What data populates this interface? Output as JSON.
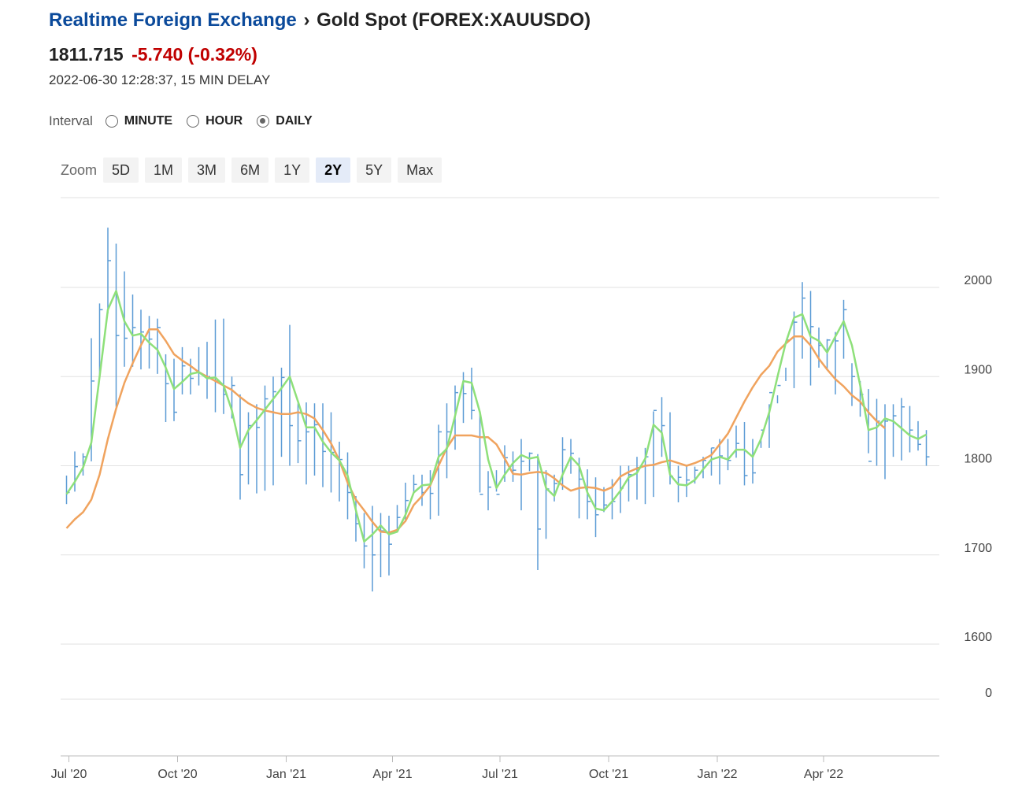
{
  "header": {
    "breadcrumb_link": "Realtime Foreign Exchange",
    "breadcrumb_sep": "›",
    "symbol_title": "Gold Spot (FOREX:XAUUSDO)",
    "price": "1811.715",
    "change": "-5.740 (-0.32%)",
    "timestamp": "2022-06-30 12:28:37, 15 MIN DELAY",
    "change_color": "#c00000",
    "link_color": "#0b4a9b"
  },
  "interval": {
    "label": "Interval",
    "options": [
      "MINUTE",
      "HOUR",
      "DAILY"
    ],
    "selected": "DAILY"
  },
  "zoom": {
    "label": "Zoom",
    "options": [
      "5D",
      "1M",
      "3M",
      "6M",
      "1Y",
      "2Y",
      "5Y",
      "Max"
    ],
    "selected": "2Y"
  },
  "chart_data": {
    "type": "line",
    "title": "",
    "xlabel": "",
    "ylabel": "",
    "x_tick_labels": [
      "Jul '20",
      "Oct '20",
      "Jan '21",
      "Apr '21",
      "Jul '21",
      "Oct '21",
      "Jan '22",
      "Apr '22"
    ],
    "y_tick_labels": [
      "2000",
      "1900",
      "1800",
      "1700",
      "1600",
      "0"
    ],
    "y_ticks": [
      2000,
      1900,
      1800,
      1700,
      1600
    ],
    "ylim": [
      1600,
      2100
    ],
    "grid": true,
    "colors": {
      "bars": "#5b9bd5",
      "fast_ma": "#8ee07a",
      "slow_ma": "#f0a35e",
      "grid": "#e2e2e2",
      "axis": "#bbbbbb"
    },
    "x": [
      "2020-06-29",
      "2020-07-06",
      "2020-07-13",
      "2020-07-20",
      "2020-07-27",
      "2020-08-03",
      "2020-08-10",
      "2020-08-17",
      "2020-08-24",
      "2020-08-31",
      "2020-09-07",
      "2020-09-14",
      "2020-09-21",
      "2020-09-28",
      "2020-10-05",
      "2020-10-12",
      "2020-10-19",
      "2020-10-26",
      "2020-11-02",
      "2020-11-09",
      "2020-11-16",
      "2020-11-23",
      "2020-11-30",
      "2020-12-07",
      "2020-12-14",
      "2020-12-21",
      "2020-12-28",
      "2021-01-04",
      "2021-01-11",
      "2021-01-18",
      "2021-01-25",
      "2021-02-01",
      "2021-02-08",
      "2021-02-15",
      "2021-02-22",
      "2021-03-01",
      "2021-03-08",
      "2021-03-15",
      "2021-03-22",
      "2021-03-29",
      "2021-04-05",
      "2021-04-12",
      "2021-04-19",
      "2021-04-26",
      "2021-05-03",
      "2021-05-10",
      "2021-05-17",
      "2021-05-24",
      "2021-05-31",
      "2021-06-07",
      "2021-06-14",
      "2021-06-21",
      "2021-06-28",
      "2021-07-05",
      "2021-07-12",
      "2021-07-19",
      "2021-07-26",
      "2021-08-02",
      "2021-08-09",
      "2021-08-16",
      "2021-08-23",
      "2021-08-30",
      "2021-09-06",
      "2021-09-13",
      "2021-09-20",
      "2021-09-27",
      "2021-10-04",
      "2021-10-11",
      "2021-10-18",
      "2021-10-25",
      "2021-11-01",
      "2021-11-08",
      "2021-11-15",
      "2021-11-22",
      "2021-11-29",
      "2021-12-06",
      "2021-12-13",
      "2021-12-20",
      "2021-12-27",
      "2022-01-03",
      "2022-01-10",
      "2022-01-17",
      "2022-01-24",
      "2022-01-31",
      "2022-02-07",
      "2022-02-14",
      "2022-02-21",
      "2022-02-28",
      "2022-03-07",
      "2022-03-14",
      "2022-03-21",
      "2022-03-28",
      "2022-04-04",
      "2022-04-11",
      "2022-04-18",
      "2022-04-25",
      "2022-05-02",
      "2022-05-09",
      "2022-05-16",
      "2022-05-23",
      "2022-05-30",
      "2022-06-06",
      "2022-06-13",
      "2022-06-20",
      "2022-06-27"
    ],
    "high": [
      1789,
      1816,
      1814,
      1943,
      1982,
      2067,
      2049,
      2018,
      1992,
      1975,
      1968,
      1965,
      1925,
      1920,
      1933,
      1920,
      1933,
      1939,
      1964,
      1965,
      1900,
      1880,
      1860,
      1869,
      1890,
      1900,
      1910,
      1958,
      1870,
      1871,
      1870,
      1870,
      1860,
      1827,
      1815,
      1766,
      1747,
      1755,
      1747,
      1744,
      1756,
      1781,
      1790,
      1790,
      1795,
      1846,
      1870,
      1890,
      1905,
      1910,
      1861,
      1794,
      1795,
      1823,
      1816,
      1830,
      1815,
      1813,
      1795,
      1790,
      1832,
      1830,
      1809,
      1796,
      1787,
      1776,
      1785,
      1800,
      1800,
      1810,
      1820,
      1861,
      1877,
      1860,
      1800,
      1800,
      1799,
      1810,
      1820,
      1830,
      1830,
      1845,
      1849,
      1830,
      1830,
      1869,
      1879,
      1910,
      1973,
      2006,
      1996,
      1955,
      1942,
      1950,
      1986,
      1915,
      1895,
      1886,
      1875,
      1869,
      1869,
      1876,
      1867,
      1850,
      1840
    ],
    "low": [
      1757,
      1771,
      1789,
      1805,
      1902,
      1971,
      1866,
      1911,
      1911,
      1908,
      1909,
      1903,
      1849,
      1850,
      1880,
      1880,
      1890,
      1875,
      1860,
      1858,
      1853,
      1762,
      1779,
      1769,
      1772,
      1778,
      1810,
      1800,
      1803,
      1779,
      1789,
      1776,
      1770,
      1760,
      1740,
      1715,
      1685,
      1659,
      1675,
      1677,
      1726,
      1737,
      1770,
      1755,
      1740,
      1744,
      1786,
      1818,
      1848,
      1852,
      1770,
      1750,
      1771,
      1782,
      1782,
      1750,
      1794,
      1683,
      1718,
      1760,
      1773,
      1791,
      1741,
      1740,
      1720,
      1748,
      1740,
      1747,
      1760,
      1762,
      1757,
      1765,
      1810,
      1779,
      1759,
      1765,
      1780,
      1786,
      1789,
      1779,
      1795,
      1809,
      1778,
      1780,
      1820,
      1820,
      1870,
      1895,
      1887,
      1920,
      1890,
      1910,
      1907,
      1880,
      1920,
      1867,
      1855,
      1814,
      1800,
      1785,
      1810,
      1806,
      1815,
      1817,
      1800
    ],
    "bar_close": [
      1770,
      1799,
      1810,
      1895,
      1975,
      2030,
      1946,
      1943,
      1955,
      1950,
      1942,
      1955,
      1892,
      1860,
      1912,
      1898,
      1904,
      1900,
      1895,
      1880,
      1890,
      1790,
      1845,
      1843,
      1875,
      1883,
      1899,
      1845,
      1828,
      1838,
      1846,
      1816,
      1815,
      1807,
      1770,
      1735,
      1710,
      1700,
      1727,
      1712,
      1742,
      1761,
      1779,
      1770,
      1769,
      1838,
      1838,
      1882,
      1881,
      1862,
      1768,
      1776,
      1768,
      1809,
      1795,
      1805,
      1814,
      1729,
      1774,
      1780,
      1818,
      1814,
      1785,
      1760,
      1745,
      1756,
      1760,
      1775,
      1790,
      1798,
      1810,
      1862,
      1845,
      1788,
      1787,
      1784,
      1795,
      1806,
      1820,
      1811,
      1806,
      1825,
      1789,
      1792,
      1840,
      1882,
      1890,
      1941,
      1961,
      1988,
      1956,
      1935,
      1941,
      1940,
      1975,
      1900,
      1880,
      1805,
      1850,
      1850,
      1856,
      1866,
      1840,
      1824,
      1810
    ],
    "series": [
      {
        "name": "",
        "color": "#8ee07a",
        "values": [
          1768,
          1782,
          1798,
          1826,
          1900,
          1975,
          1996,
          1962,
          1946,
          1948,
          1938,
          1930,
          1910,
          1886,
          1894,
          1903,
          1905,
          1898,
          1899,
          1890,
          1862,
          1820,
          1840,
          1851,
          1863,
          1875,
          1887,
          1900,
          1872,
          1843,
          1843,
          1827,
          1815,
          1806,
          1789,
          1750,
          1715,
          1723,
          1733,
          1723,
          1726,
          1745,
          1770,
          1778,
          1779,
          1810,
          1819,
          1856,
          1895,
          1893,
          1860,
          1807,
          1775,
          1790,
          1803,
          1812,
          1808,
          1810,
          1775,
          1766,
          1790,
          1810,
          1800,
          1770,
          1752,
          1750,
          1760,
          1772,
          1787,
          1792,
          1808,
          1846,
          1837,
          1790,
          1779,
          1778,
          1784,
          1796,
          1807,
          1810,
          1807,
          1818,
          1818,
          1810,
          1830,
          1860,
          1900,
          1938,
          1966,
          1970,
          1945,
          1940,
          1927,
          1945,
          1962,
          1935,
          1890,
          1840,
          1843,
          1853,
          1850,
          1842,
          1834,
          1830,
          1835
        ]
      },
      {
        "name": "",
        "color": "#f0a35e",
        "values": [
          1730,
          1740,
          1748,
          1762,
          1790,
          1830,
          1864,
          1893,
          1915,
          1935,
          1953,
          1953,
          1940,
          1925,
          1918,
          1912,
          1905,
          1900,
          1895,
          1890,
          1885,
          1877,
          1870,
          1865,
          1862,
          1860,
          1858,
          1858,
          1860,
          1858,
          1853,
          1840,
          1825,
          1806,
          1781,
          1762,
          1750,
          1737,
          1726,
          1725,
          1728,
          1738,
          1756,
          1766,
          1778,
          1800,
          1820,
          1834,
          1834,
          1834,
          1832,
          1832,
          1824,
          1808,
          1791,
          1790,
          1792,
          1793,
          1792,
          1786,
          1778,
          1772,
          1775,
          1776,
          1775,
          1772,
          1776,
          1788,
          1793,
          1797,
          1800,
          1801,
          1804,
          1806,
          1803,
          1800,
          1803,
          1807,
          1812,
          1824,
          1836,
          1854,
          1872,
          1888,
          1902,
          1912,
          1928,
          1937,
          1945,
          1945,
          1935,
          1920,
          1908,
          1897,
          1889,
          1879,
          1872,
          1860,
          1850,
          1842
        ]
      }
    ]
  }
}
